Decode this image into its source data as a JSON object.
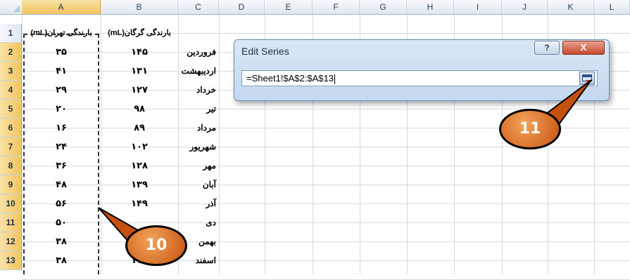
{
  "columns": [
    "A",
    "B",
    "C",
    "D",
    "E",
    "F",
    "G",
    "H",
    "I",
    "J",
    "K",
    "L"
  ],
  "rows": [
    "1",
    "2",
    "3",
    "4",
    "5",
    "6",
    "7",
    "8",
    "9",
    "10",
    "11",
    "12",
    "13"
  ],
  "header_row": {
    "A": "بارندگی تهران(mL)",
    "B": "بارندگی گرگان(mL)"
  },
  "data": [
    {
      "a": "۳۵",
      "b": "۱۴۵",
      "month": "فروردین"
    },
    {
      "a": "۴۱",
      "b": "۱۳۱",
      "month": "اردیبهشت"
    },
    {
      "a": "۲۹",
      "b": "۱۲۷",
      "month": "خرداد"
    },
    {
      "a": "۲۰",
      "b": "۹۸",
      "month": "تیر"
    },
    {
      "a": "۱۶",
      "b": "۸۹",
      "month": "مرداد"
    },
    {
      "a": "۲۴",
      "b": "۱۰۲",
      "month": "شهریور"
    },
    {
      "a": "۳۶",
      "b": "۱۲۸",
      "month": "مهر"
    },
    {
      "a": "۴۸",
      "b": "۱۳۹",
      "month": "آبان"
    },
    {
      "a": "۵۶",
      "b": "۱۴۹",
      "month": "آذر"
    },
    {
      "a": "۵۰",
      "b": "",
      "month": "دی"
    },
    {
      "a": "۳۸",
      "b": "",
      "month": "بهمن"
    },
    {
      "a": "۳۸",
      "b": "۱۱۶",
      "month": "اسفند"
    }
  ],
  "dialog": {
    "title": "Edit Series",
    "help_label": "?",
    "close_label": "X",
    "range_value": "=Sheet1!$A$2:$A$13"
  },
  "callouts": {
    "badge_10": "10",
    "badge_11": "11"
  },
  "colors": {
    "selected_header": "#f2c45e",
    "callout_fill": "#e07a2a",
    "dialog_bg": "#c4d8ef",
    "close_button": "#c64b2e"
  }
}
